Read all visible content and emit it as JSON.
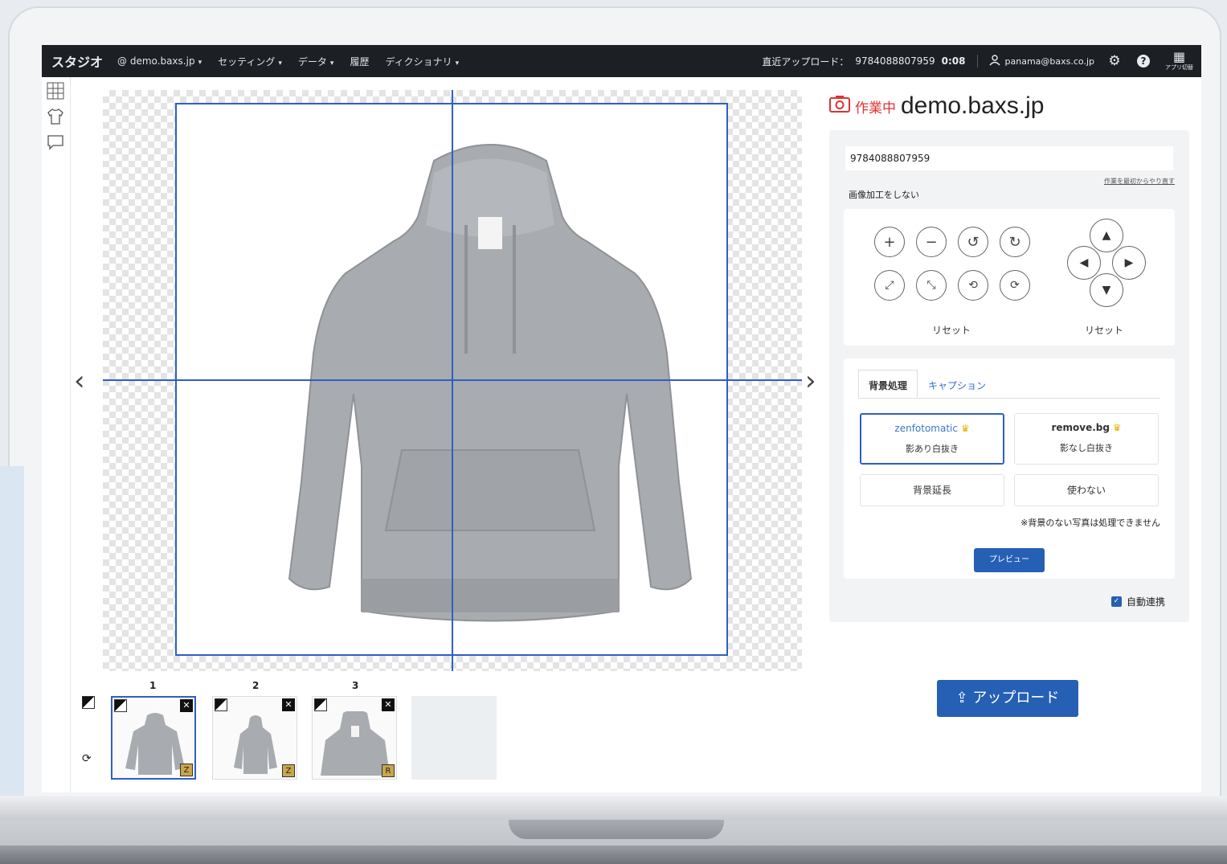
{
  "topbar": {
    "brand": "スタジオ",
    "account": "@ demo.baxs.jp",
    "menu": [
      "セッティング",
      "データ",
      "履歴",
      "ディクショナリ"
    ],
    "recent_label": "直近アップロード：",
    "recent_code": "9784088807959",
    "recent_time": "0:08",
    "user_email": "panama@baxs.co.jp",
    "apps_label": "アプリ切替"
  },
  "canvas": {
    "prev": "‹",
    "next": "›"
  },
  "thumbnails": [
    {
      "number": "1",
      "tag": "Z",
      "selected": true
    },
    {
      "number": "2",
      "tag": "Z",
      "selected": false
    },
    {
      "number": "3",
      "tag": "R",
      "selected": false
    }
  ],
  "right": {
    "status": "作業中",
    "site": "demo.baxs.jp",
    "code": "9784088807959",
    "redo_link": "作業を最初からやり直す",
    "no_processing": "画像加工をしない",
    "reset_left": "リセット",
    "reset_right": "リセット",
    "tabs": [
      "背景処理",
      "キャプション"
    ],
    "options": {
      "zenfotomatic": {
        "brand": "zenfotomatic",
        "desc": "影あり白抜き"
      },
      "removebg": {
        "brand": "remove.bg",
        "desc": "影なし白抜き"
      },
      "extend": "背景延長",
      "none": "使わない"
    },
    "note": "※背景のない写真は処理できません",
    "preview": "プレビュー",
    "auto_link": "自動連携",
    "upload": "アップロード"
  }
}
